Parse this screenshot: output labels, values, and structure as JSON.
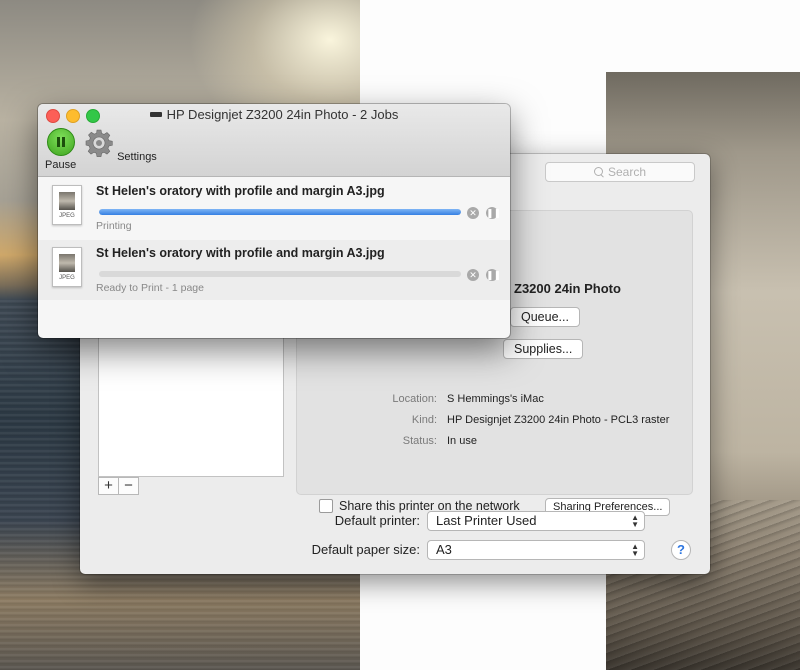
{
  "queue_window": {
    "title": "HP Designjet Z3200 24in Photo - 2 Jobs",
    "toolbar": {
      "pause_label": "Pause",
      "settings_label": "Settings"
    },
    "jobs": [
      {
        "name": "St Helen's oratory with profile and margin A3.jpg",
        "status": "Printing",
        "progress": 1.0,
        "file_type": "JPEG"
      },
      {
        "name": "St Helen's oratory with profile and margin A3.jpg",
        "status": "Ready to Print - 1 page",
        "progress": 0,
        "file_type": "JPEG"
      }
    ]
  },
  "prefs_window": {
    "search_placeholder": "Search",
    "printer_name": "Z3200 24in Photo",
    "open_queue_label": "Queue...",
    "supplies_label": "Supplies...",
    "info": [
      {
        "label": "Location:",
        "value": "S Hemmings's iMac"
      },
      {
        "label": "Kind:",
        "value": "HP Designjet Z3200 24in Photo - PCL3 raster"
      },
      {
        "label": "Status:",
        "value": "In use"
      }
    ],
    "share_label": "Share this printer on the network",
    "share_checked": false,
    "sharing_prefs_label": "Sharing Preferences...",
    "list_add_label": "+",
    "list_remove_label": "−",
    "default_printer_label": "Default printer:",
    "default_printer_value": "Last Printer Used",
    "default_paper_label": "Default paper size:",
    "default_paper_value": "A3",
    "help_label": "?"
  },
  "colors": {
    "progress_blue": "#3580e2",
    "pause_green": "#3ea31e",
    "help_blue": "#2d76e0"
  }
}
